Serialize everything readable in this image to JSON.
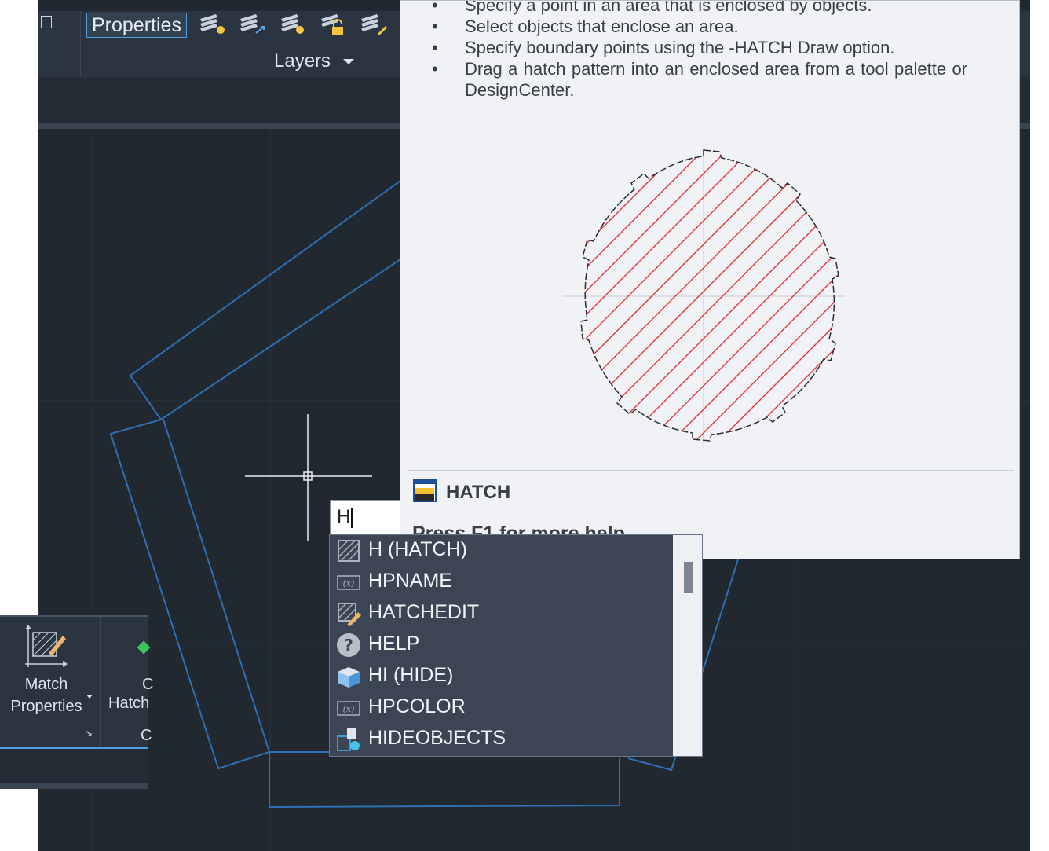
{
  "ribbon": {
    "properties_label": "Properties",
    "layers_label": "Layers"
  },
  "tooltip": {
    "bullets": [
      "Specify a point in an area that is enclosed by objects.",
      "Select objects that enclose an area.",
      "Specify boundary points using the -HATCH Draw option.",
      "Drag a hatch pattern into an enclosed area from a tool palette or DesignCenter."
    ],
    "command_name": "HATCH",
    "help_hint": "Press F1 for more help"
  },
  "command": {
    "input_value": "H"
  },
  "autocomplete": {
    "items": [
      {
        "label": "H (HATCH)",
        "icon": "hatch-icon"
      },
      {
        "label": "HPNAME",
        "icon": "system-variable-icon"
      },
      {
        "label": "HATCHEDIT",
        "icon": "hatch-edit-icon"
      },
      {
        "label": "HELP",
        "icon": "help-icon"
      },
      {
        "label": "HI (HIDE)",
        "icon": "hide-icon"
      },
      {
        "label": "HPCOLOR",
        "icon": "system-variable-icon"
      },
      {
        "label": "HIDEOBJECTS",
        "icon": "hide-objects-icon"
      }
    ]
  },
  "panel": {
    "match_line1": "Match",
    "match_line2": "Properties",
    "hatch_fragment": "Hatch",
    "c_fragment_top": "C",
    "c_fragment_bottom": "C"
  },
  "colors": {
    "canvas": "#212830",
    "ribbon": "#2b3441",
    "geometry_blue": "#2f6fb4",
    "hatch_red": "#e0363b"
  }
}
